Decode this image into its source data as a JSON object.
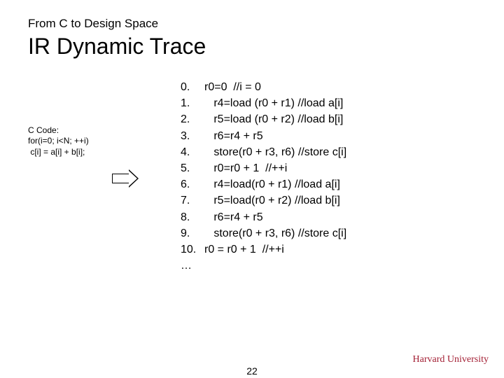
{
  "pretitle": "From C to Design Space",
  "title": "IR Dynamic Trace",
  "ccode": {
    "label": "C Code:",
    "lines": [
      "for(i=0; i<N; ++i)",
      " c[i] = a[i] + b[i];"
    ]
  },
  "trace": [
    {
      "n": "0.",
      "prefix": "",
      "text": "r0=0  //i = 0"
    },
    {
      "n": "1.",
      "prefix": "   ",
      "text": "r4=load (r0 + r1) //load a[i]"
    },
    {
      "n": "2.",
      "prefix": "   ",
      "text": "r5=load (r0 + r2) //load b[i]"
    },
    {
      "n": "3.",
      "prefix": "   ",
      "text": "r6=r4 + r5"
    },
    {
      "n": "4.",
      "prefix": "   ",
      "text": "store(r0 + r3, r6) //store c[i]"
    },
    {
      "n": "5.",
      "prefix": "   ",
      "text": "r0=r0 + 1  //++i"
    },
    {
      "n": "6.",
      "prefix": "   ",
      "text": "r4=load(r0 + r1) //load a[i]"
    },
    {
      "n": "7.",
      "prefix": "   ",
      "text": "r5=load(r0 + r2) //load b[i]"
    },
    {
      "n": "8.",
      "prefix": "   ",
      "text": "r6=r4 + r5"
    },
    {
      "n": "9.",
      "prefix": "   ",
      "text": "store(r0 + r3, r6) //store c[i]"
    },
    {
      "n": "10.",
      "prefix": "",
      "text": "r0 = r0 + 1  //++i"
    },
    {
      "n": "…",
      "prefix": "",
      "text": ""
    }
  ],
  "footer": {
    "page": "22",
    "org": "Harvard University"
  }
}
